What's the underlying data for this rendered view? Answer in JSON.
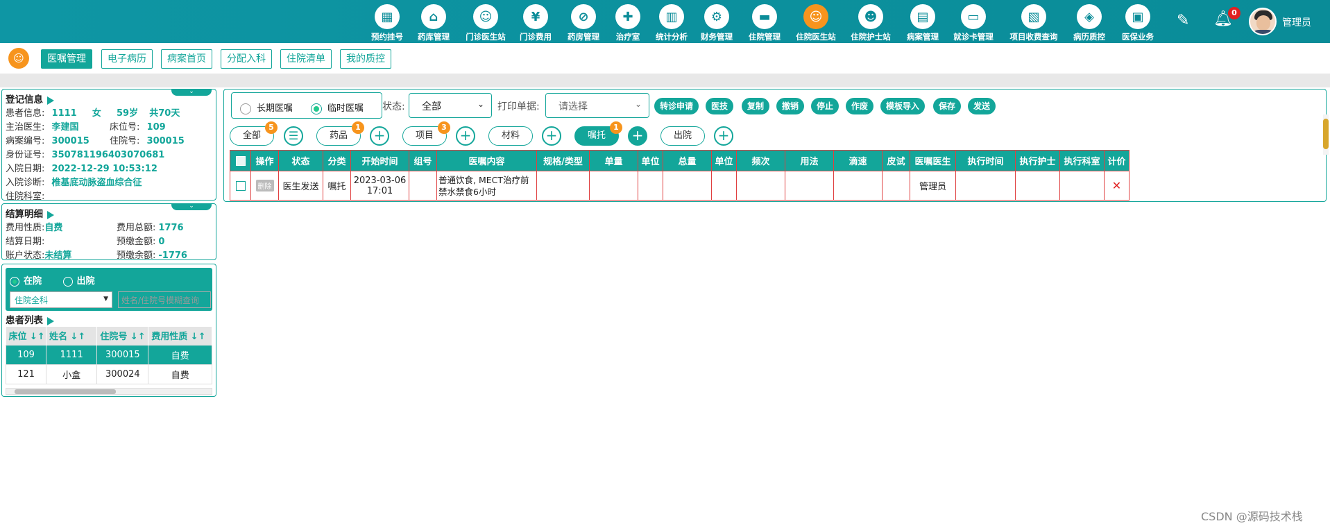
{
  "nav": [
    {
      "label": "预约挂号",
      "icon": "calendar-icon",
      "glyph": "▦"
    },
    {
      "label": "药库管理",
      "icon": "warehouse-icon",
      "glyph": "⌂"
    },
    {
      "label": "门诊医生站",
      "icon": "doctor-icon",
      "glyph": "☺"
    },
    {
      "label": "门诊费用",
      "icon": "yen-icon",
      "glyph": "¥"
    },
    {
      "label": "药房管理",
      "icon": "pill-icon",
      "glyph": "⊘"
    },
    {
      "label": "治疗室",
      "icon": "nurse-icon",
      "glyph": "✚"
    },
    {
      "label": "统计分析",
      "icon": "chart-icon",
      "glyph": "▥"
    },
    {
      "label": "财务管理",
      "icon": "gear-icon",
      "glyph": "⚙"
    },
    {
      "label": "住院管理",
      "icon": "bed-icon",
      "glyph": "▬"
    },
    {
      "label": "住院医生站",
      "icon": "inpatient-doctor-icon",
      "glyph": "☺"
    },
    {
      "label": "住院护士站",
      "icon": "nurse-station-icon",
      "glyph": "☻"
    },
    {
      "label": "病案管理",
      "icon": "record-icon",
      "glyph": "▤"
    },
    {
      "label": "就诊卡管理",
      "icon": "card-icon",
      "glyph": "▭"
    },
    {
      "label": "项目收费查询",
      "icon": "invoice-icon",
      "glyph": "▧"
    },
    {
      "label": "病历质控",
      "icon": "quality-icon",
      "glyph": "◈"
    },
    {
      "label": "医保业务",
      "icon": "insurance-icon",
      "glyph": "▣"
    }
  ],
  "header": {
    "notify_count": "0",
    "username": "管理员",
    "edit_glyph": "✎",
    "bell_glyph": "🔔︎"
  },
  "subtabs": [
    "医嘱管理",
    "电子病历",
    "病案首页",
    "分配入科",
    "住院清单",
    "我的质控"
  ],
  "registration": {
    "title": "登记信息",
    "patient_label": "患者信息:",
    "patient_name": "1111",
    "gender": "女",
    "age": "59岁",
    "days": "共70天",
    "doctor_label": "主治医生:",
    "doctor": "李建国",
    "bed_label": "床位号:",
    "bed": "109",
    "case_label": "病案编号:",
    "case_no": "300015",
    "inpatient_label": "住院号:",
    "inpatient_no": "300015",
    "id_label": "身份证号:",
    "id_no": "350781196403070681",
    "admit_date_label": "入院日期:",
    "admit_date": "2022-12-29 10:53:12",
    "diagnosis_label": "入院诊断:",
    "diagnosis": "椎基底动脉盗血综合征",
    "dept_label": "住院科室:",
    "dept": ""
  },
  "billing": {
    "title": "结算明细",
    "fee_type_label": "费用性质:",
    "fee_type": "自费",
    "total_label": "费用总额:",
    "total": "1776",
    "settle_date_label": "结算日期:",
    "settle_date": "",
    "prepay_label": "预缴金额:",
    "prepay": "0",
    "account_label": "账户状态:",
    "account": "未结算",
    "balance_label": "预缴余额:",
    "balance": "-1776"
  },
  "patient_list": {
    "radio_in": "在院",
    "radio_out": "出院",
    "ward_select": "住院全科",
    "search_placeholder": "姓名/住院号模糊查询",
    "title": "患者列表",
    "columns": [
      "床位",
      "姓名",
      "住院号",
      "费用性质"
    ],
    "rows": [
      {
        "bed": "109",
        "name": "1111",
        "no": "300015",
        "fee": "自费"
      },
      {
        "bed": "121",
        "name": "小盒",
        "no": "300024",
        "fee": "自费"
      }
    ]
  },
  "orders": {
    "type_long": "长期医嘱",
    "type_temp": "临时医嘱",
    "status_label": "状态:",
    "status_value": "全部",
    "print_label": "打印单据:",
    "print_placeholder": "请选择",
    "actions": [
      "转诊申请",
      "医技",
      "复制",
      "撤销",
      "停止",
      "作废",
      "模板导入",
      "保存",
      "发送"
    ],
    "filters": [
      {
        "label": "全部",
        "badge": "5"
      },
      {
        "label": "药品",
        "badge": "1"
      },
      {
        "label": "项目",
        "badge": "3"
      },
      {
        "label": "材料",
        "badge": ""
      },
      {
        "label": "嘱托",
        "badge": "1"
      },
      {
        "label": "出院",
        "badge": ""
      }
    ],
    "columns": [
      "操作",
      "状态",
      "分类",
      "开始时间",
      "组号",
      "医嘱内容",
      "规格/类型",
      "单量",
      "单位",
      "总量",
      "单位",
      "频次",
      "用法",
      "滴速",
      "皮试",
      "医嘱医生",
      "执行时间",
      "执行护士",
      "执行科室",
      "计价"
    ],
    "rows": [
      {
        "op": "删除",
        "status": "医生发送",
        "category": "嘱托",
        "start_date": "2023-03-06",
        "start_time": "17:01",
        "group": "",
        "content": "普通饮食, MECT治疗前禁水禁食6小时",
        "spec": "",
        "qty": "",
        "unit": "",
        "total": "",
        "unit2": "",
        "freq": "",
        "usage": "",
        "drip": "",
        "skin": "",
        "doctor": "管理员",
        "exec_time": "",
        "exec_nurse": "",
        "exec_dept": "",
        "price_glyph": "✕"
      }
    ]
  },
  "watermark": "CSDN @源码技术栈"
}
